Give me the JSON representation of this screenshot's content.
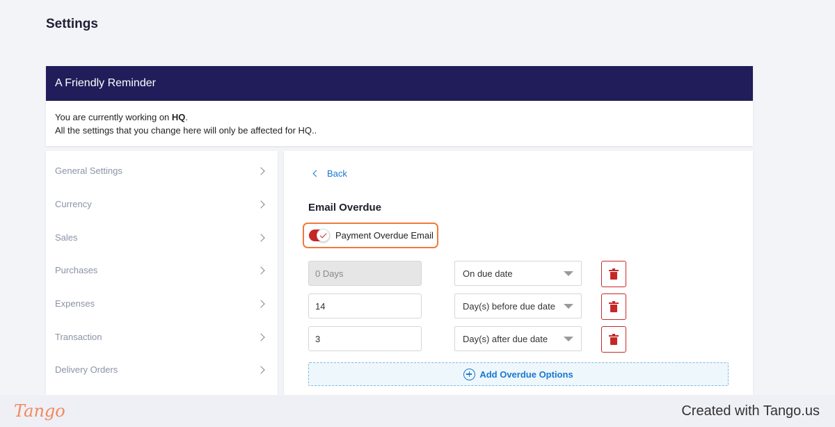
{
  "page": {
    "title": "Settings"
  },
  "reminder": {
    "header": "A Friendly Reminder",
    "line1_prefix": "You are currently working on ",
    "line1_bold": "HQ",
    "line1_suffix": ".",
    "line2": "All the settings that you change here will only be affected for HQ.."
  },
  "sidebar": {
    "items": [
      {
        "label": "General Settings",
        "icon": "chevron-right-icon"
      },
      {
        "label": "Currency",
        "icon": "chevron-right-icon"
      },
      {
        "label": "Sales",
        "icon": "chevron-right-icon"
      },
      {
        "label": "Purchases",
        "icon": "chevron-right-icon"
      },
      {
        "label": "Expenses",
        "icon": "chevron-right-icon"
      },
      {
        "label": "Transaction",
        "icon": "chevron-right-icon"
      },
      {
        "label": "Delivery Orders",
        "icon": "chevron-right-icon"
      }
    ]
  },
  "main": {
    "back_label": "Back",
    "section_title": "Email Overdue",
    "toggle": {
      "label": "Payment Overdue Email",
      "checked": true,
      "color": "#c62828"
    },
    "rows": [
      {
        "days": "0 Days",
        "disabled": true,
        "option": "On due date"
      },
      {
        "days": "14",
        "disabled": false,
        "option": "Day(s) before due date"
      },
      {
        "days": "3",
        "disabled": false,
        "option": "Day(s) after due date"
      }
    ],
    "add_label": "Add Overdue Options"
  },
  "footer": {
    "logo": "Tango",
    "created": "Created with Tango.us"
  },
  "colors": {
    "header_bg": "#201d5a",
    "accent_blue": "#1976d2",
    "danger": "#c62828",
    "highlight": "#f07a3a"
  }
}
